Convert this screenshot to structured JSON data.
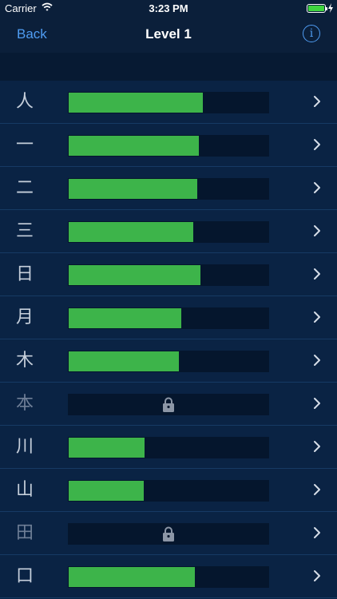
{
  "status": {
    "carrier": "Carrier",
    "time": "3:23 PM"
  },
  "nav": {
    "back_label": "Back",
    "title": "Level 1",
    "info_glyph": "i"
  },
  "colors": {
    "accent": "#4f9cf2",
    "progress": "#3db44a",
    "track": "#05162d",
    "background": "#0a2344"
  },
  "rows": [
    {
      "kanji": "人",
      "progress": 0.67,
      "locked": false
    },
    {
      "kanji": "一",
      "progress": 0.65,
      "locked": false
    },
    {
      "kanji": "二",
      "progress": 0.645,
      "locked": false
    },
    {
      "kanji": "三",
      "progress": 0.625,
      "locked": false
    },
    {
      "kanji": "日",
      "progress": 0.66,
      "locked": false
    },
    {
      "kanji": "月",
      "progress": 0.565,
      "locked": false
    },
    {
      "kanji": "木",
      "progress": 0.55,
      "locked": false
    },
    {
      "kanji": "本",
      "progress": 0,
      "locked": true
    },
    {
      "kanji": "川",
      "progress": 0.38,
      "locked": false
    },
    {
      "kanji": "山",
      "progress": 0.375,
      "locked": false
    },
    {
      "kanji": "田",
      "progress": 0,
      "locked": true
    },
    {
      "kanji": "口",
      "progress": 0.63,
      "locked": false
    }
  ]
}
